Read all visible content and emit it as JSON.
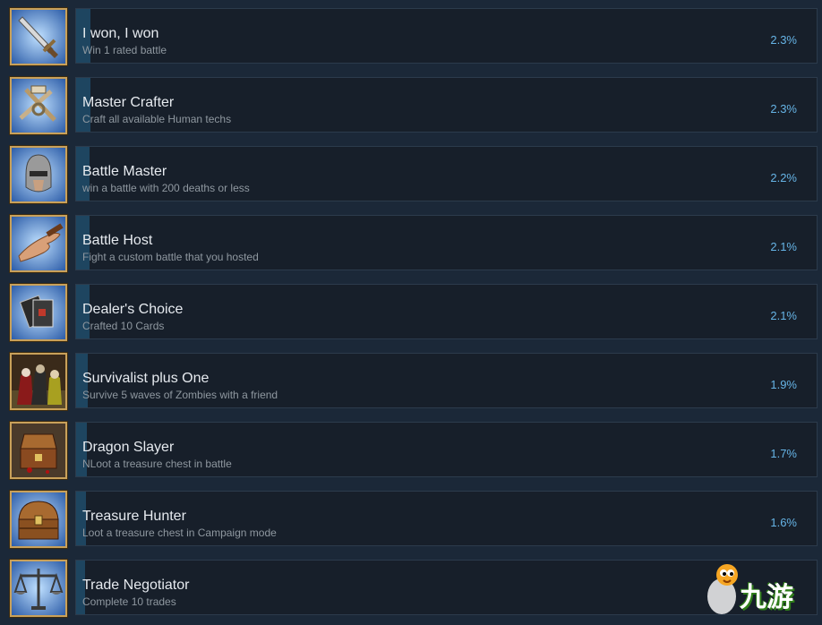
{
  "achievements": [
    {
      "title": "I won, I won",
      "desc": "Win 1 rated battle",
      "percent": "2.3%",
      "progress_pct": 2.3,
      "icon": "sword-icon"
    },
    {
      "title": "Master Crafter",
      "desc": "Craft all available Human techs",
      "percent": "2.3%",
      "progress_pct": 2.3,
      "icon": "crafting-tools-icon"
    },
    {
      "title": "Battle Master",
      "desc": "win a battle with 200 deaths or less",
      "percent": "2.2%",
      "progress_pct": 2.2,
      "icon": "knight-helmet-icon"
    },
    {
      "title": "Battle Host",
      "desc": "Fight a custom battle that you hosted",
      "percent": "2.1%",
      "progress_pct": 2.1,
      "icon": "open-hand-icon"
    },
    {
      "title": "Dealer's Choice",
      "desc": "Crafted 10 Cards",
      "percent": "2.1%",
      "progress_pct": 2.1,
      "icon": "cards-icon"
    },
    {
      "title": "Survivalist plus One",
      "desc": "Survive 5 waves of Zombies with a friend",
      "percent": "1.9%",
      "progress_pct": 1.9,
      "icon": "zombies-icon"
    },
    {
      "title": "Dragon Slayer",
      "desc": "NLoot a treasure chest in battle",
      "percent": "1.7%",
      "progress_pct": 1.7,
      "icon": "open-chest-icon"
    },
    {
      "title": "Treasure Hunter",
      "desc": "Loot a treasure chest in Campaign mode",
      "percent": "1.6%",
      "progress_pct": 1.6,
      "icon": "treasure-chest-icon"
    },
    {
      "title": "Trade Negotiator",
      "desc": "Complete 10 trades",
      "percent": "",
      "progress_pct": 1.5,
      "icon": "scales-icon"
    }
  ],
  "watermark": {
    "text": "九游",
    "icon": "mascot-icon"
  },
  "colors": {
    "background": "#1b2838",
    "panel": "#171f2a",
    "progress_bar": "#1e4560",
    "percent_text": "#66b4e6",
    "icon_frame": "#c9a15a"
  }
}
